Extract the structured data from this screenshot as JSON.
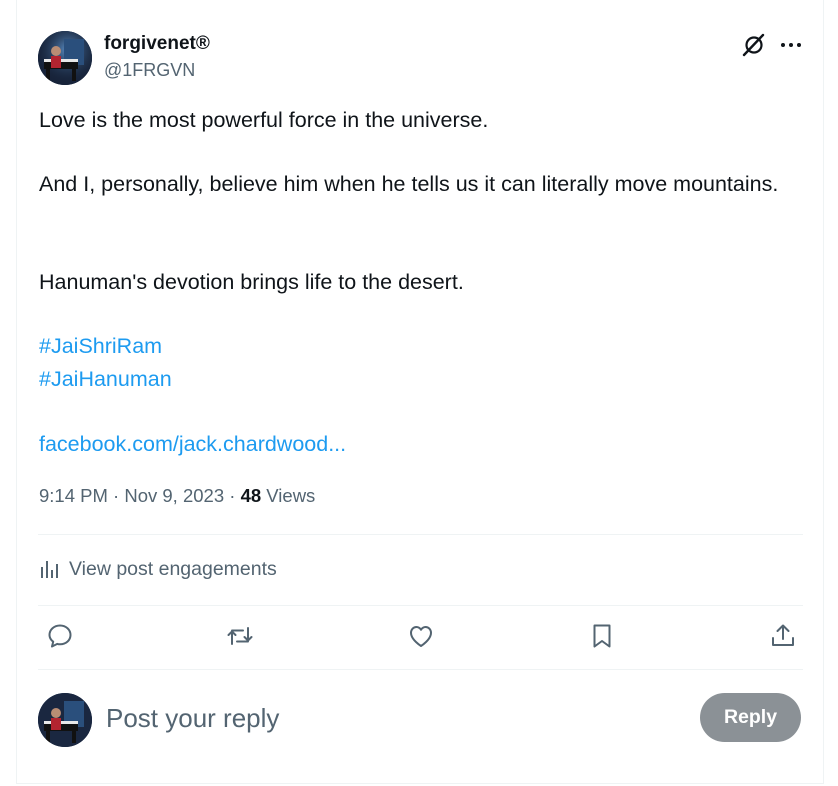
{
  "author": {
    "display_name": "forgivenet®",
    "handle": "@1FRGVN",
    "avatar_icon": "profile-photo-pianist"
  },
  "post": {
    "paragraph_1": "Love is the most powerful force in the universe.",
    "paragraph_2": "And I, personally, believe him when he tells us it can literally move mountains.",
    "paragraph_3": "Hanuman's devotion brings life to the desert.",
    "hashtags": [
      "#JaiShriRam",
      "#JaiHanuman"
    ],
    "link": "facebook.com/jack.chardwood..."
  },
  "meta": {
    "time": "9:14 PM",
    "separator": "·",
    "date": "Nov 9, 2023",
    "views_count": "48",
    "views_label": "Views"
  },
  "engagements": {
    "label": "View post engagements",
    "icon": "analytics-bars-icon"
  },
  "actions": {
    "icons": [
      "reply-icon",
      "repost-icon",
      "like-icon",
      "bookmark-icon",
      "share-icon"
    ]
  },
  "top_icons": [
    "grok-icon",
    "more-icon"
  ],
  "reply_box": {
    "placeholder": "Post your reply",
    "button_label": "Reply"
  },
  "colors": {
    "link": "#1d9bf0",
    "text": "#0f1419",
    "secondary": "#536471",
    "reply_button_disabled": "#8b9196",
    "divider": "#eff3f4"
  }
}
